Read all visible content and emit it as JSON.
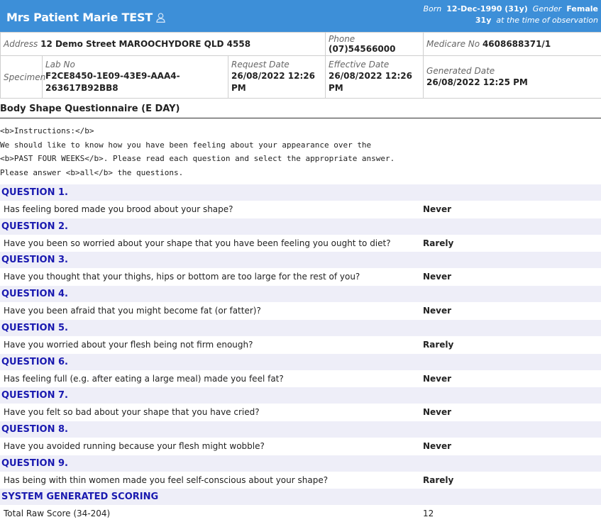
{
  "header": {
    "patient_name": "Mrs Patient Marie TEST",
    "born_label": "Born",
    "born_value": "12-Dec-1990 (31y)",
    "gender_label": "Gender",
    "gender_value": "Female",
    "age_value": "31y",
    "age_note": "at the time of observation"
  },
  "info": {
    "address_label": "Address",
    "address_value": "12 Demo Street MAROOCHYDORE QLD 4558",
    "phone_label": "Phone",
    "phone_value": "(07)54566000",
    "medicare_label": "Medicare No",
    "medicare_value": "4608688371/1",
    "specimen_label": "Specimen",
    "labno_label": "Lab No",
    "labno_value": "F2CE8450-1E09-43E9-AAA4-263617B92BB8",
    "request_label": "Request Date",
    "request_value": "26/08/2022 12:26 PM",
    "effective_label": "Effective Date",
    "effective_value": "26/08/2022 12:26 PM",
    "generated_label": "Generated Date",
    "generated_value": "26/08/2022 12:25 PM"
  },
  "title": "Body Shape Questionnaire (E DAY)",
  "instructions": "<b>Instructions:</b>\nWe should like to know how you have been feeling about your appearance over the\n<b>PAST FOUR WEEKS</b>. Please read each question and select the appropriate answer.\nPlease answer <b>all</b> the questions.",
  "questions": [
    {
      "label": "QUESTION 1.",
      "text": "Has feeling bored made you brood about your shape?",
      "answer": "Never"
    },
    {
      "label": "QUESTION 2.",
      "text": "Have you been so worried about your shape that you have been feeling you ought to diet?",
      "answer": "Rarely"
    },
    {
      "label": "QUESTION 3.",
      "text": "Have you thought that your thighs, hips or bottom are too large for the rest of you?",
      "answer": "Never"
    },
    {
      "label": "QUESTION 4.",
      "text": "Have you been afraid that you might become fat (or fatter)?",
      "answer": "Never"
    },
    {
      "label": "QUESTION 5.",
      "text": "Have you worried about your flesh being not firm enough?",
      "answer": "Rarely"
    },
    {
      "label": "QUESTION 6.",
      "text": "Has feeling full (e.g. after eating a large meal) made you feel fat?",
      "answer": "Never"
    },
    {
      "label": "QUESTION 7.",
      "text": "Have you felt so bad about your shape that you have cried?",
      "answer": "Never"
    },
    {
      "label": "QUESTION 8.",
      "text": "Have you avoided running because your flesh might wobble?",
      "answer": "Never"
    },
    {
      "label": "QUESTION 9.",
      "text": "Has being with thin women made you feel self-conscious about your shape?",
      "answer": "Rarely"
    }
  ],
  "scoring": {
    "label": "SYSTEM GENERATED SCORING",
    "text": "Total Raw Score (34-204)",
    "value": "12"
  }
}
